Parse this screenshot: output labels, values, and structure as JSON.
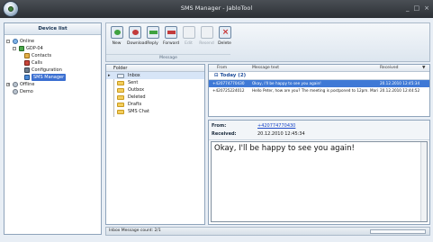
{
  "window": {
    "title": "SMS Manager - JabloTool",
    "controls": [
      "_",
      "□",
      "×"
    ]
  },
  "sidebar": {
    "title": "Device list",
    "items": [
      {
        "label": "Online",
        "level": 0,
        "expander": "-",
        "icon": "globe-icon"
      },
      {
        "label": "GDP-04",
        "level": 1,
        "expander": "-",
        "icon": "device-icon"
      },
      {
        "label": "Contacts",
        "level": 2,
        "icon": "contacts-icon"
      },
      {
        "label": "Calls",
        "level": 2,
        "icon": "phone-icon"
      },
      {
        "label": "Configuration",
        "level": 2,
        "icon": "gear-icon"
      },
      {
        "label": "SMS Manager",
        "level": 2,
        "icon": "sms-icon",
        "selected": true
      },
      {
        "label": "Offline",
        "level": 0,
        "expander": "+",
        "icon": "globe-icon"
      },
      {
        "label": "Demo",
        "level": 0,
        "icon": "globe-icon"
      }
    ]
  },
  "toolbar": {
    "buttons": [
      {
        "label": "New",
        "icon": "new-message-icon",
        "enabled": true
      },
      {
        "label": "Download",
        "icon": "download-icon",
        "enabled": true
      },
      {
        "label": "Reply",
        "icon": "reply-icon",
        "enabled": true
      },
      {
        "label": "Forward",
        "icon": "forward-icon",
        "enabled": true
      },
      {
        "label": "Edit",
        "icon": "edit-icon",
        "enabled": false
      },
      {
        "label": "Resend",
        "icon": "resend-icon",
        "enabled": false
      },
      {
        "label": "Delete",
        "icon": "delete-icon",
        "enabled": true
      }
    ],
    "group_label": "Message"
  },
  "folders": {
    "header": "Folder",
    "items": [
      {
        "label": "Inbox",
        "selected": true
      },
      {
        "label": "Sent"
      },
      {
        "label": "Outbox"
      },
      {
        "label": "Deleted"
      },
      {
        "label": "Drafts"
      },
      {
        "label": "SMS Chat"
      }
    ]
  },
  "message_list": {
    "columns": {
      "from": "From",
      "text": "Message text",
      "received": "Received"
    },
    "group": "Today (2)",
    "rows": [
      {
        "from": "+420774770430",
        "text": "Okay, I'll be happy to see you again!",
        "received": "20.12.2010 12:45:34",
        "selected": true
      },
      {
        "from": "+420725224012",
        "text": "Hello Peter, how are you? The meeting is postponed to 12pm. Maria",
        "received": "20.12.2010 12:44:52"
      }
    ]
  },
  "reader": {
    "from_label": "From:",
    "from_value": "+420774770430",
    "received_label": "Received:",
    "received_value": "20.12.2010 12:45:34",
    "body": "Okay, I'll be happy to see you again!"
  },
  "statusbar": {
    "text": "Inbox Message count: 2/1"
  },
  "colors": {
    "selection": "#3f79d6",
    "link": "#1b47c8",
    "group_text": "#1d4c9a"
  }
}
